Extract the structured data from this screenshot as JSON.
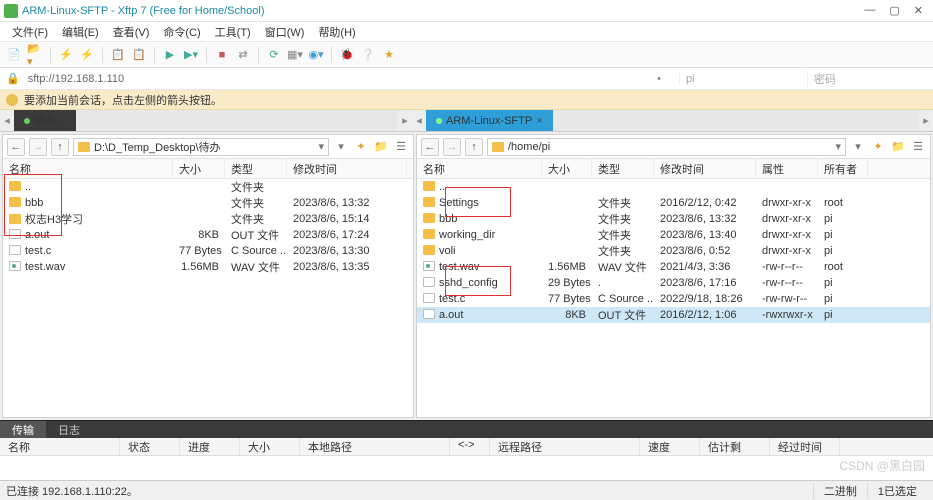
{
  "window": {
    "title": "ARM-Linux-SFTP - Xftp 7 (Free for Home/School)"
  },
  "menu": {
    "items": [
      "文件(F)",
      "编辑(E)",
      "查看(V)",
      "命令(C)",
      "工具(T)",
      "窗口(W)",
      "帮助(H)"
    ]
  },
  "address": {
    "url": "sftp://192.168.1.110",
    "user": "pi",
    "pass": "密码"
  },
  "hint": {
    "text": "要添加当前会话，点击左侧的箭头按钮。"
  },
  "tabs": {
    "left": "待办",
    "right": "ARM-Linux-SFTP"
  },
  "paneL": {
    "path": "D:\\D_Temp_Desktop\\待办",
    "cols": [
      "名称",
      "大小",
      "类型",
      "修改时间"
    ],
    "widths": [
      170,
      52,
      62,
      120
    ],
    "rows": [
      {
        "icon": "folder",
        "name": "..",
        "size": "",
        "type": "文件夹",
        "date": ""
      },
      {
        "icon": "folder",
        "name": "bbb",
        "size": "",
        "type": "文件夹",
        "date": "2023/8/6, 13:32"
      },
      {
        "icon": "folder",
        "name": "权志H3学习",
        "size": "",
        "type": "文件夹",
        "date": "2023/8/6, 15:14"
      },
      {
        "icon": "file",
        "name": "a.out",
        "size": "8KB",
        "type": "OUT 文件",
        "date": "2023/8/6, 17:24"
      },
      {
        "icon": "file",
        "name": "test.c",
        "size": "77 Bytes",
        "type": "C Source ...",
        "date": "2023/8/6, 13:30"
      },
      {
        "icon": "wav",
        "name": "test.wav",
        "size": "1.56MB",
        "type": "WAV 文件",
        "date": "2023/8/6, 13:35"
      }
    ]
  },
  "paneR": {
    "path": "/home/pi",
    "cols": [
      "名称",
      "大小",
      "类型",
      "修改时间",
      "属性",
      "所有者"
    ],
    "widths": [
      125,
      50,
      62,
      102,
      62,
      50
    ],
    "rows": [
      {
        "icon": "folder",
        "name": "..",
        "size": "",
        "type": "",
        "date": "",
        "attr": "",
        "own": ""
      },
      {
        "icon": "folder",
        "name": "Settings",
        "size": "",
        "type": "文件夹",
        "date": "2016/2/12, 0:42",
        "attr": "drwxr-xr-x",
        "own": "root"
      },
      {
        "icon": "folder",
        "name": "bbb",
        "size": "",
        "type": "文件夹",
        "date": "2023/8/6, 13:32",
        "attr": "drwxr-xr-x",
        "own": "pi"
      },
      {
        "icon": "folder",
        "name": "working_dir",
        "size": "",
        "type": "文件夹",
        "date": "2023/8/6, 13:40",
        "attr": "drwxr-xr-x",
        "own": "pi"
      },
      {
        "icon": "folder",
        "name": "voli",
        "size": "",
        "type": "文件夹",
        "date": "2023/8/6, 0:52",
        "attr": "drwxr-xr-x",
        "own": "pi"
      },
      {
        "icon": "wav",
        "name": "test.wav",
        "size": "1.56MB",
        "type": "WAV 文件",
        "date": "2021/4/3, 3:36",
        "attr": "-rw-r--r--",
        "own": "root"
      },
      {
        "icon": "file",
        "name": "sshd_config",
        "size": "29 Bytes",
        "type": ".",
        "date": "2023/8/6, 17:16",
        "attr": "-rw-r--r--",
        "own": "pi"
      },
      {
        "icon": "file",
        "name": "test.c",
        "size": "77 Bytes",
        "type": "C Source ...",
        "date": "2022/9/18, 18:26",
        "attr": "-rw-rw-r--",
        "own": "pi"
      },
      {
        "icon": "file",
        "name": "a.out",
        "size": "8KB",
        "type": "OUT 文件",
        "date": "2016/2/12, 1:06",
        "attr": "-rwxrwxr-x",
        "own": "pi",
        "sel": true
      }
    ]
  },
  "xfer": {
    "tabs": [
      "传输",
      "日志"
    ],
    "cols": [
      "名称",
      "状态",
      "进度",
      "大小",
      "本地路径",
      "<->",
      "远程路径",
      "速度",
      "估计剩余...",
      "经过时间"
    ]
  },
  "status": {
    "conn": "已连接 192.168.1.110:22。",
    "enc": "二进制",
    "sel": "1已选定"
  },
  "watermark": "CSDN @黑白园"
}
